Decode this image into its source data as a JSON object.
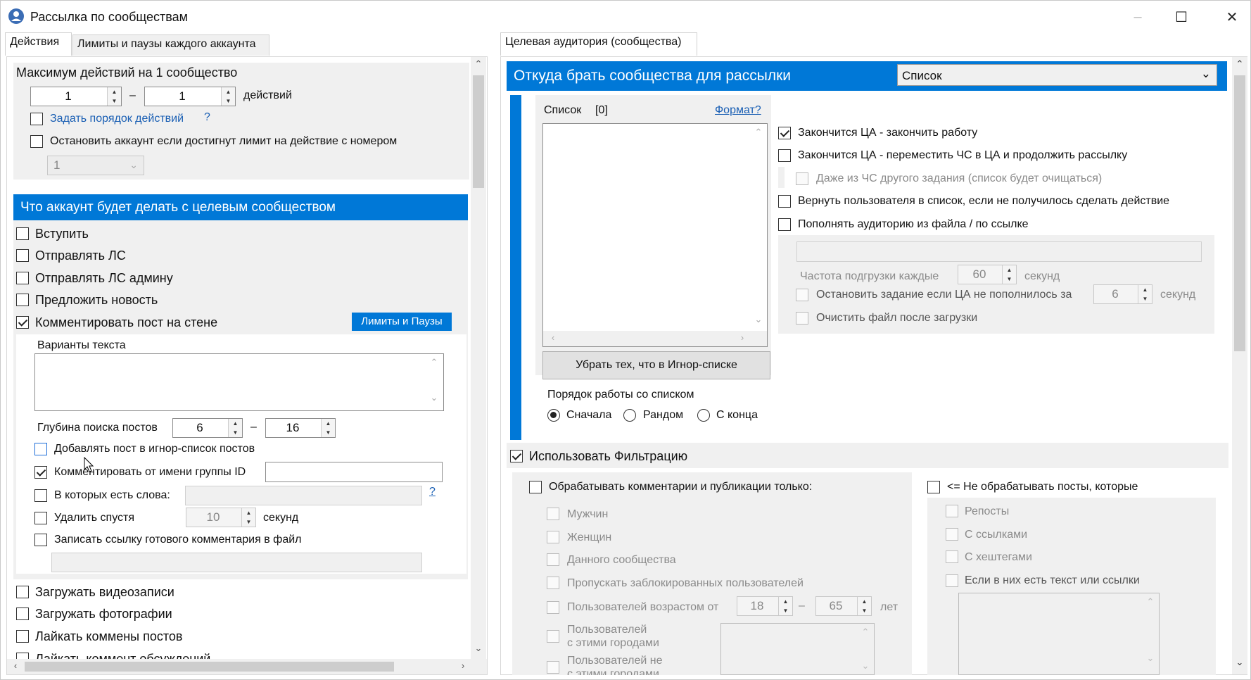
{
  "window": {
    "title": "Рассылка по сообществам",
    "minimize": "–",
    "maximize": "☐",
    "close": "✕"
  },
  "left": {
    "tabs": [
      "Действия",
      "Лимиты и паузы каждого аккаунта"
    ],
    "max_actions_label": "Максимум действий на 1 сообщество",
    "max_from": "1",
    "max_to": "1",
    "dash": "–",
    "actions_word": "действий",
    "set_order": "Задать порядок действий",
    "q": "?",
    "stop_account": "Остановить аккаунт если достигнут лимит на действие с номером",
    "stop_num": "1",
    "section_title": "Что аккаунт будет делать с целевым сообществом",
    "join": "Вступить",
    "send_pm": "Отправлять ЛС",
    "send_pm_admin": "Отправлять ЛС админу",
    "suggest_news": "Предложить новость",
    "comment_wall": "Комментировать пост на стене",
    "limits_btn": "Лимиты и Паузы",
    "text_variants": "Варианты текста",
    "depth_label": "Глубина поиска постов",
    "depth_from": "6",
    "depth_to": "16",
    "add_ignore": "Добавлять пост в игнор-список постов",
    "comment_group": "Комментировать от имени группы ID",
    "with_words": "В которых есть слова:",
    "delete_after": "Удалить спустя",
    "delete_val": "10",
    "seconds": "секунд",
    "save_link": "Записать ссылку готового комментария в файл",
    "upload_video": "Загружать видеозаписи",
    "upload_photo": "Загружать фотографии",
    "like_comments": "Лайкать коммены постов",
    "like_discussions": "Лайкать коммент обсуждений"
  },
  "right": {
    "tab": "Целевая аудитория (сообщества)",
    "source_title": "Откуда брать сообщества для рассылки",
    "source_value": "Список",
    "list_label": "Список",
    "list_count": "[0]",
    "format_link": "Формат?",
    "remove_ignore_btn": "Убрать тех, что в Игнор-списке",
    "order_label": "Порядок работы со списком",
    "order_first": "Сначала",
    "order_random": "Рандом",
    "order_end": "С конца",
    "opt_end_ca": "Закончится ЦА - закончить работу",
    "opt_move_bl": "Закончится ЦА - переместить ЧС в ЦА и продолжить рассылку",
    "opt_other_bl": "Даже из ЧС другого задания (список будет очищаться)",
    "opt_return": "Вернуть пользователя в список, если не получилось сделать действие",
    "opt_refill": "Пополнять аудиторию из файла / по ссылке",
    "freq_label": "Частота подгрузки каждые",
    "freq_val": "60",
    "sec": "секунд",
    "stop_task": "Остановить задание если ЦА не пополнилось за",
    "stop_val": "6",
    "clear_file": "Очистить файл после загрузки",
    "use_filter": "Использовать Фильтрацию",
    "process_only": "Обрабатывать комментарии и публикации только:",
    "men": "Мужчин",
    "women": "Женщин",
    "this_community": "Данного сообщества",
    "skip_blocked": "Пропускать заблокированных пользователей",
    "age_label": "Пользователей возрастом от",
    "age_from": "18",
    "age_to": "65",
    "years": "лет",
    "cities1": "Пользователей",
    "cities2": "с этими городами",
    "notcities1": "Пользователей не",
    "notcities2": "с этими городами",
    "dont_process": "<= Не обрабатывать посты, которые",
    "reposts": "Репосты",
    "with_links": "С ссылками",
    "with_hashtags": "С хештегами",
    "with_text": "Если в них есть текст или ссылки"
  }
}
